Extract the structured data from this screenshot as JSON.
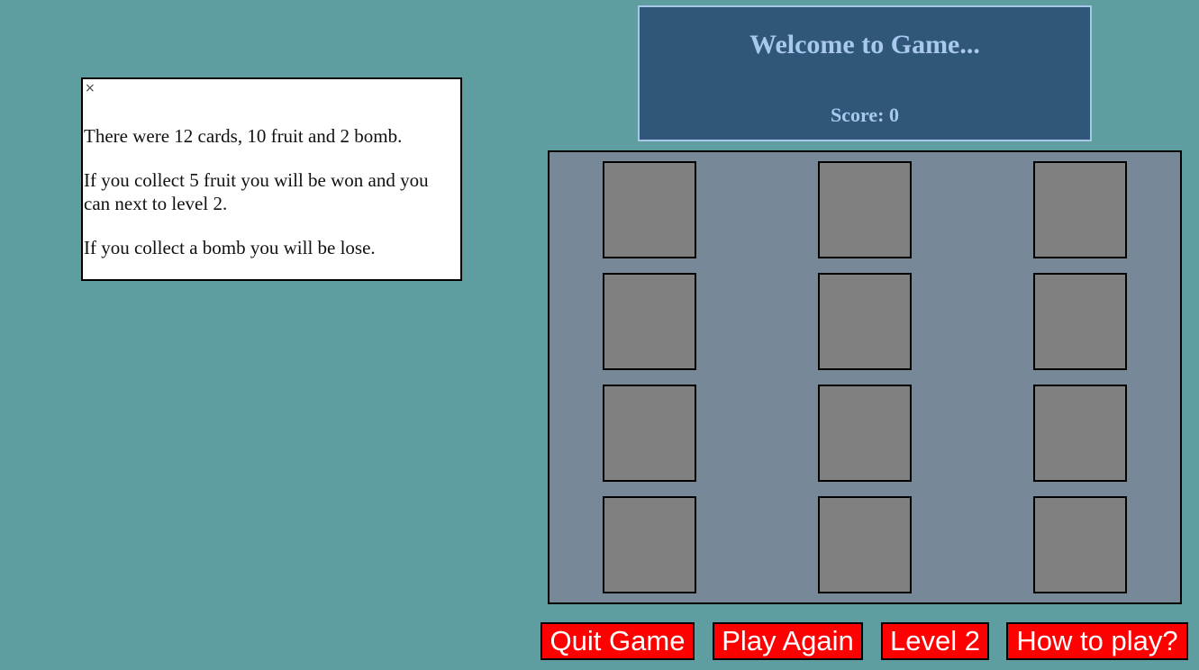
{
  "info": {
    "close": "×",
    "lines": [
      "There were 12 cards, 10 fruit and 2 bomb.",
      "If you collect 5 fruit you will be won and you can next to level 2.",
      "If you collect a bomb you will be lose."
    ]
  },
  "header": {
    "title": "Welcome to Game...",
    "score": "Score: 0"
  },
  "board": {
    "rows": 4,
    "cols": 3,
    "card_color": "#808080"
  },
  "buttons": {
    "quit": "Quit Game",
    "play_again": "Play Again",
    "level2": "Level 2",
    "how_to": "How to play?"
  },
  "colors": {
    "background": "#5f9ea0",
    "header_bg": "#30577a",
    "board_bg": "#778899",
    "button_bg": "#ff0000"
  }
}
